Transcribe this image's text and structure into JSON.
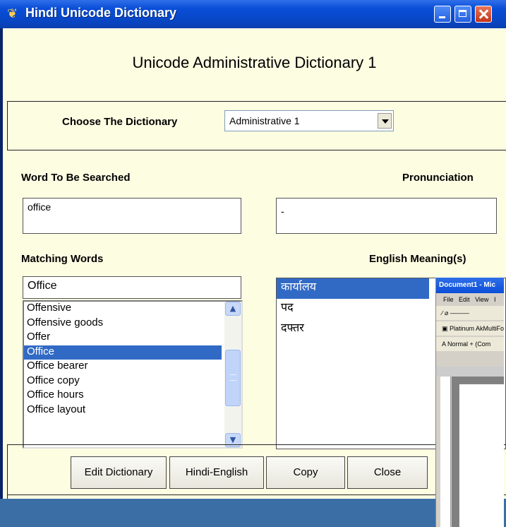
{
  "window": {
    "title": "Hindi Unicode Dictionary",
    "title_icon": "dictionary-app-icon"
  },
  "heading": "Unicode Administrative Dictionary 1",
  "dictionary_select": {
    "label": "Choose The Dictionary",
    "value": "Administrative 1"
  },
  "search": {
    "label": "Word To Be Searched",
    "value": "office"
  },
  "pronunciation": {
    "label": "Pronunciation",
    "value": "-"
  },
  "matching": {
    "label": "Matching Words",
    "filter_value": "Office",
    "items": [
      "Offensive",
      "Offensive goods",
      "Offer",
      "Office",
      "Office bearer",
      "Office copy",
      "Office hours",
      "Office layout"
    ],
    "selected_index": 3
  },
  "meanings": {
    "label": "English Meaning(s)",
    "items": [
      "कार्यालय",
      "पद",
      "दफ्तर"
    ],
    "selected_index": 0
  },
  "buttons": {
    "edit": "Edit Dictionary",
    "hindi_english": "Hindi-English",
    "copy": "Copy",
    "close": "Close"
  },
  "word_window": {
    "title": "Document1 - Mic",
    "menu": [
      "File",
      "Edit",
      "View",
      "I"
    ],
    "toolbar_font": "Platinum AkMultiFont",
    "style_box": "Normal + (Com"
  },
  "colors": {
    "title_bar": "#0a4ed8",
    "client_bg": "#fdfde2",
    "selection": "#316ac5"
  }
}
